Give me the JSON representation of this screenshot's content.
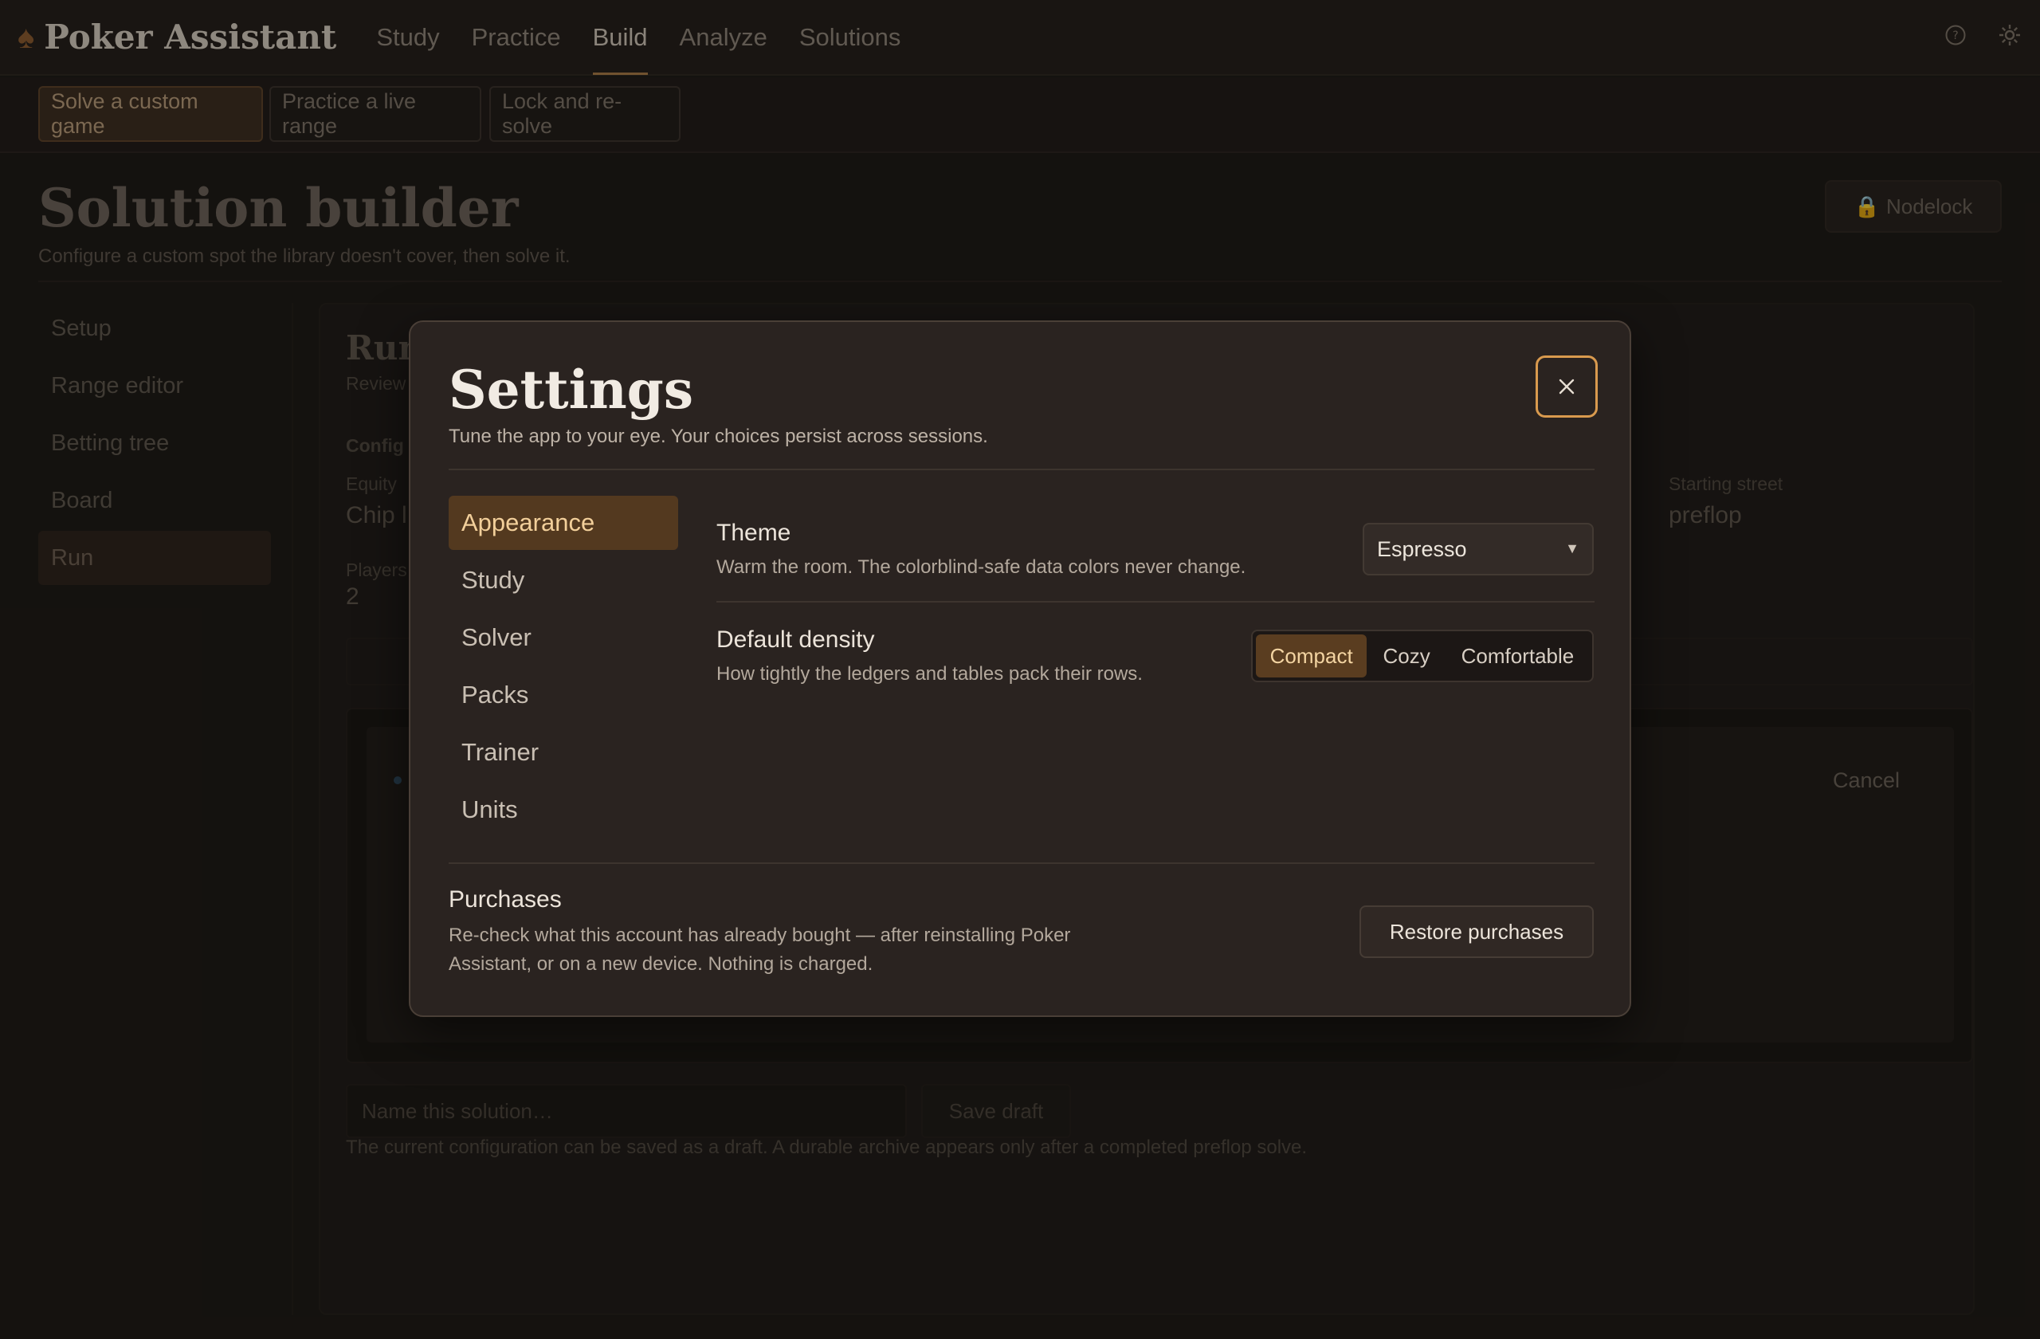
{
  "app": {
    "brand": "Poker Assistant",
    "nav": [
      "Study",
      "Practice",
      "Build",
      "Analyze",
      "Solutions"
    ],
    "active_nav": "Build",
    "icons": [
      "help-icon",
      "gear-icon"
    ]
  },
  "subnav": {
    "chips": [
      "Solve a custom game",
      "Practice a live range",
      "Lock and re-solve"
    ],
    "active": "Solve a custom game"
  },
  "page": {
    "title": "Solution builder",
    "subtitle": "Configure a custom spot the library doesn't cover, then solve it.",
    "nodelock_label": "Nodelock",
    "sidebar": [
      "Setup",
      "Range editor",
      "Betting tree",
      "Board",
      "Run"
    ],
    "sidebar_active": "Run",
    "run_heading": "Run",
    "run_sub": "Review",
    "config_label": "Config",
    "equity_label": "Equity",
    "equity_value": "Chip l",
    "players_label": "Players",
    "players_value": "2",
    "starting_street_label": "Starting street",
    "starting_street_value": "preflop",
    "cancel_label": "Cancel",
    "name_placeholder": "Name this solution…",
    "save_draft_label": "Save draft",
    "footnote": "The current configuration can be saved as a draft. A durable archive appears only after a completed preflop solve."
  },
  "settings": {
    "title": "Settings",
    "subtitle": "Tune the app to your eye. Your choices persist across sessions.",
    "tabs": [
      "Appearance",
      "Study",
      "Solver",
      "Packs",
      "Trainer",
      "Units"
    ],
    "active_tab": "Appearance",
    "theme": {
      "label": "Theme",
      "description": "Warm the room. The colorblind-safe data colors never change.",
      "value": "Espresso"
    },
    "density": {
      "label": "Default density",
      "description": "How tightly the ledgers and tables pack their rows.",
      "options": [
        "Compact",
        "Cozy",
        "Comfortable"
      ],
      "selected": "Compact"
    },
    "purchases": {
      "label": "Purchases",
      "description_line1": "Re-check what this account has already bought — after reinstalling Poker",
      "description_line2": "Assistant, or on a new device. Nothing is charged.",
      "button": "Restore purchases"
    }
  },
  "colors": {
    "accent": "#d99a4e",
    "active_tab_bg": "#53391f",
    "modal_bg": "#2a2320",
    "page_bg": "#1b1714"
  }
}
